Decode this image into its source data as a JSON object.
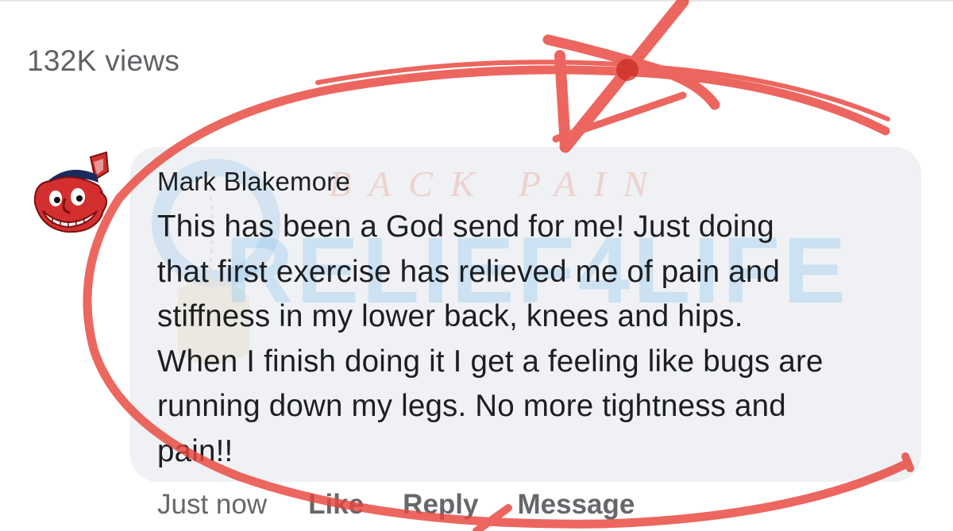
{
  "post": {
    "views": "132K views"
  },
  "comment": {
    "author": "Mark Blakemore",
    "text": "This has been a God send for me! Just doing\nthat first exercise has relieved me of pain and\nstiffness in my lower back, knees and hips.\nWhen I finish doing it I get a feeling like bugs are\nrunning down my legs. No more tightness and\npain!!",
    "timestamp": "Just now",
    "actions": {
      "like": "Like",
      "reply": "Reply",
      "message": "Message"
    },
    "avatar_icon": "cartoon-mascot-logo"
  },
  "watermark": {
    "line1": "BACK PAIN",
    "line2": "RELIEF4LIFE"
  },
  "colors": {
    "bubble": "#eff1f4",
    "text": "#1c1e21",
    "meta": "#65676b",
    "annotation": "#e8453c",
    "watermark_blue": "#5ba8e6"
  }
}
